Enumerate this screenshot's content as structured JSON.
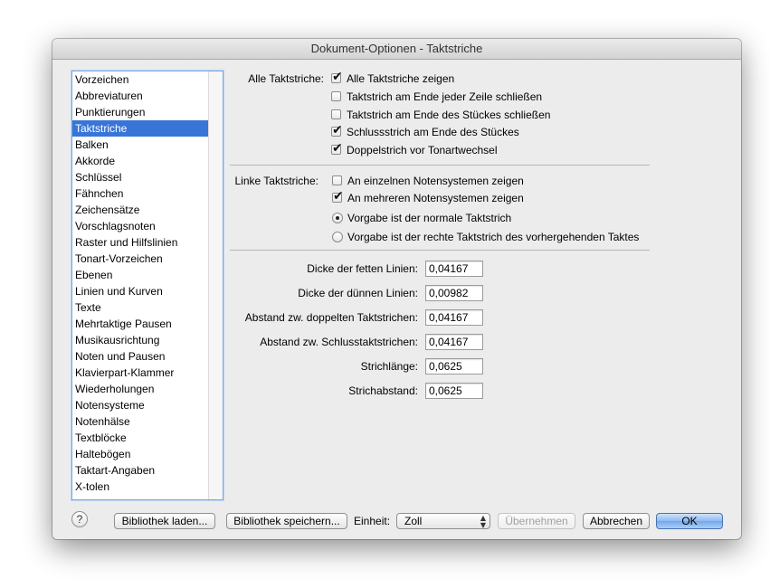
{
  "window": {
    "title": "Dokument-Optionen - Taktstriche"
  },
  "sidebar": {
    "items": [
      {
        "label": "Vorzeichen"
      },
      {
        "label": "Abbreviaturen"
      },
      {
        "label": "Punktierungen"
      },
      {
        "label": "Taktstriche",
        "selected": true
      },
      {
        "label": "Balken"
      },
      {
        "label": "Akkorde"
      },
      {
        "label": "Schlüssel"
      },
      {
        "label": "Fähnchen"
      },
      {
        "label": "Zeichensätze"
      },
      {
        "label": "Vorschlagsnoten"
      },
      {
        "label": "Raster und Hilfslinien"
      },
      {
        "label": "Tonart-Vorzeichen"
      },
      {
        "label": "Ebenen"
      },
      {
        "label": "Linien und Kurven"
      },
      {
        "label": "Texte"
      },
      {
        "label": "Mehrtaktige Pausen"
      },
      {
        "label": "Musikausrichtung"
      },
      {
        "label": "Noten und Pausen"
      },
      {
        "label": "Klavierpart-Klammer"
      },
      {
        "label": "Wiederholungen"
      },
      {
        "label": "Notensysteme"
      },
      {
        "label": "Notenhälse"
      },
      {
        "label": "Textblöcke"
      },
      {
        "label": "Haltebögen"
      },
      {
        "label": "Taktart-Angaben"
      },
      {
        "label": "X-tolen"
      }
    ]
  },
  "alle": {
    "section_label": "Alle Taktstriche:",
    "options": [
      {
        "label": "Alle Taktstriche zeigen",
        "checked": true
      },
      {
        "label": "Taktstrich am Ende jeder Zeile schließen",
        "checked": false
      },
      {
        "label": "Taktstrich am Ende des Stückes schließen",
        "checked": false
      },
      {
        "label": "Schlussstrich am Ende des Stückes",
        "checked": true
      },
      {
        "label": "Doppelstrich vor Tonartwechsel",
        "checked": true
      }
    ]
  },
  "linke": {
    "section_label": "Linke Taktstriche:",
    "options": [
      {
        "label": "An einzelnen Notensystemen zeigen",
        "checked": false
      },
      {
        "label": "An mehreren Notensystemen zeigen",
        "checked": true
      }
    ],
    "radios": [
      {
        "label": "Vorgabe ist der normale Taktstrich",
        "selected": true
      },
      {
        "label": "Vorgabe ist der rechte Taktstrich des vorhergehenden Taktes",
        "selected": false
      }
    ]
  },
  "fields": [
    {
      "label": "Dicke der fetten Linien:",
      "value": "0,04167"
    },
    {
      "label": "Dicke der dünnen Linien:",
      "value": "0,00982"
    },
    {
      "label": "Abstand zw. doppelten Taktstrichen:",
      "value": "0,04167"
    },
    {
      "label": "Abstand zw. Schlusstaktstrichen:",
      "value": "0,04167"
    },
    {
      "label": "Strichlänge:",
      "value": "0,0625"
    },
    {
      "label": "Strichabstand:",
      "value": "0,0625"
    }
  ],
  "footer": {
    "help_label": "?",
    "load_label": "Bibliothek laden...",
    "save_label": "Bibliothek speichern...",
    "unit_label": "Einheit:",
    "unit_value": "Zoll",
    "apply_label": "Übernehmen",
    "cancel_label": "Abbrechen",
    "ok_label": "OK"
  }
}
